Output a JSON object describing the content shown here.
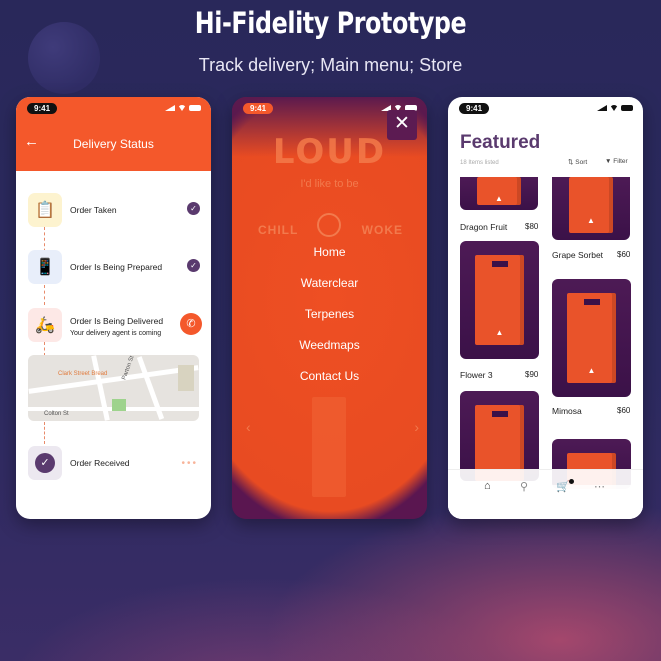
{
  "page": {
    "title": "Hi-Fidelity Prototype",
    "subtitle": "Track delivery; Main menu; Store"
  },
  "status_time": "9:41",
  "delivery": {
    "title": "Delivery Status",
    "back_icon": "arrow-left-icon",
    "steps": [
      {
        "label": "Order Taken",
        "icon": "clipboard-icon",
        "state": "done"
      },
      {
        "label": "Order Is Being Prepared",
        "icon": "tablet-icon",
        "state": "done"
      },
      {
        "label": "Order Is Being Delivered",
        "sub": "Your delivery agent is coming",
        "icon": "scooter-icon",
        "state": "in-progress",
        "action_icon": "phone-icon"
      },
      {
        "label": "Order Received",
        "icon": "check-circle-icon",
        "state": "pending"
      }
    ],
    "map": {
      "street_labels": [
        "Clark Street Bread",
        "Parton St",
        "Colton St"
      ]
    }
  },
  "menu": {
    "brand": "LOUD",
    "tagline": "I'd like to be",
    "scale_left": "CHILL",
    "scale_right": "WOKE",
    "items": [
      "Home",
      "Waterclear",
      "Terpenes",
      "Weedmaps",
      "Contact Us"
    ],
    "close_icon": "close-icon"
  },
  "store": {
    "title": "Featured",
    "count_text": "18 Items listed",
    "sort_label": "Sort",
    "filter_label": "Filter",
    "products": [
      {
        "name": "Dragon Fruit",
        "price": "$80"
      },
      {
        "name": "Grape Sorbet",
        "price": "$60"
      },
      {
        "name": "Flower 3",
        "price": "$90"
      },
      {
        "name": "Mimosa",
        "price": "$60"
      }
    ],
    "tabs": [
      "home-icon",
      "search-icon",
      "cart-icon",
      "more-icon"
    ]
  },
  "colors": {
    "accent": "#f4582b",
    "purple": "#5a3a6e",
    "background": "#2a2a5c"
  }
}
